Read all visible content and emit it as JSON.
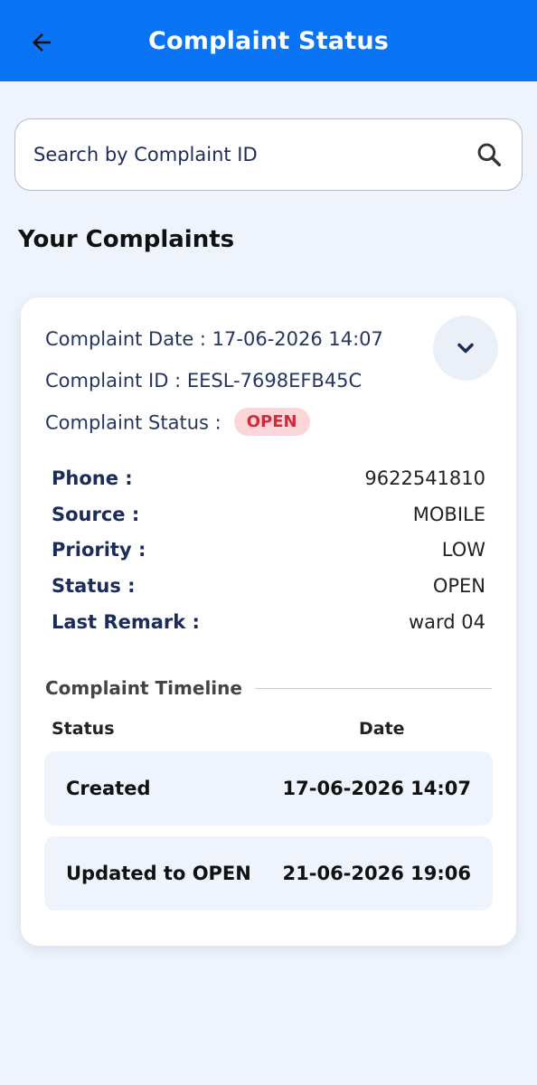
{
  "appbar": {
    "title": "Complaint Status",
    "back_icon": "arrow-left-icon"
  },
  "search": {
    "placeholder": "Search by Complaint ID",
    "value": "",
    "icon": "search-icon"
  },
  "section_title": "Your Complaints",
  "complaint": {
    "date_line": "Complaint Date : 17-06-2026 14:07",
    "id_line": "Complaint ID : EESL-7698EFB45C",
    "status_label": "Complaint Status :",
    "status_badge": "OPEN",
    "expand_icon": "chevron-down-icon",
    "details": [
      {
        "label": "Phone :",
        "value": "9622541810"
      },
      {
        "label": "Source :",
        "value": "MOBILE"
      },
      {
        "label": "Priority :",
        "value": "LOW"
      },
      {
        "label": "Status :",
        "value": "OPEN"
      },
      {
        "label": "Last Remark :",
        "value": "ward 04"
      }
    ],
    "timeline": {
      "title": "Complaint Timeline",
      "col_status": "Status",
      "col_date": "Date",
      "rows": [
        {
          "status": "Created",
          "date": "17-06-2026 14:07"
        },
        {
          "status": "Updated to OPEN",
          "date": "21-06-2026 19:06"
        }
      ]
    }
  },
  "colors": {
    "primary": "#0a74f5",
    "background": "#eff3fb",
    "label_navy": "#1c2c5a",
    "badge_bg": "#fbd5d8",
    "badge_text": "#d02b37"
  }
}
